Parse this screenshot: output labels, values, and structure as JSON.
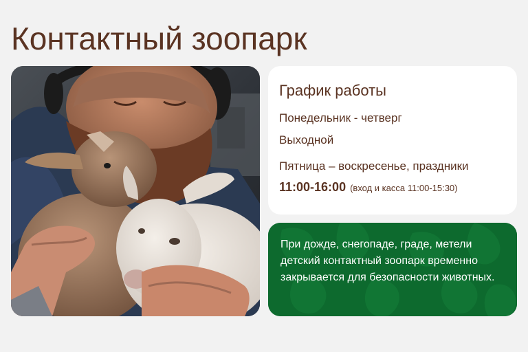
{
  "page": {
    "title": "Контактный зоопарк"
  },
  "photo": {
    "alt": "Мужчина держит двух козлят"
  },
  "schedule": {
    "title": "График работы",
    "weekday_label": "Понедельник - четверг",
    "weekday_status": "Выходной",
    "weekend_label": "Пятница – воскресенье, праздники",
    "weekend_hours": "11:00-16:00",
    "weekend_note": "(вход и касса 11:00-15:30)"
  },
  "notice": {
    "text": "При дожде, снегопаде, граде, метели детский контактный зоопарк временно закрывается для безопасности животных."
  },
  "colors": {
    "title_brown": "#5a3322",
    "notice_green": "#0d6a2e",
    "page_bg": "#f2f2f2",
    "card_bg": "#ffffff"
  }
}
